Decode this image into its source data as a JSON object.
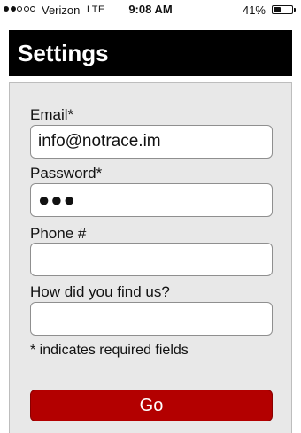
{
  "status_bar": {
    "carrier": "Verizon",
    "network": "LTE",
    "time": "9:08 AM",
    "battery_percent": "41%",
    "battery_level": 0.41,
    "signal_bars_filled": 2,
    "signal_bars_total": 5
  },
  "header": {
    "title": "Settings"
  },
  "form": {
    "email_label": "Email*",
    "email_value": "info@notrace.im",
    "password_label": "Password*",
    "password_value": "●●●",
    "phone_label": "Phone #",
    "phone_value": "",
    "referral_label": "How did you find us?",
    "referral_value": "",
    "required_note": "* indicates required fields",
    "submit_label": "Go"
  },
  "colors": {
    "header_bg": "#000000",
    "panel_bg": "#e8e8e8",
    "button_bg": "#b30000"
  }
}
